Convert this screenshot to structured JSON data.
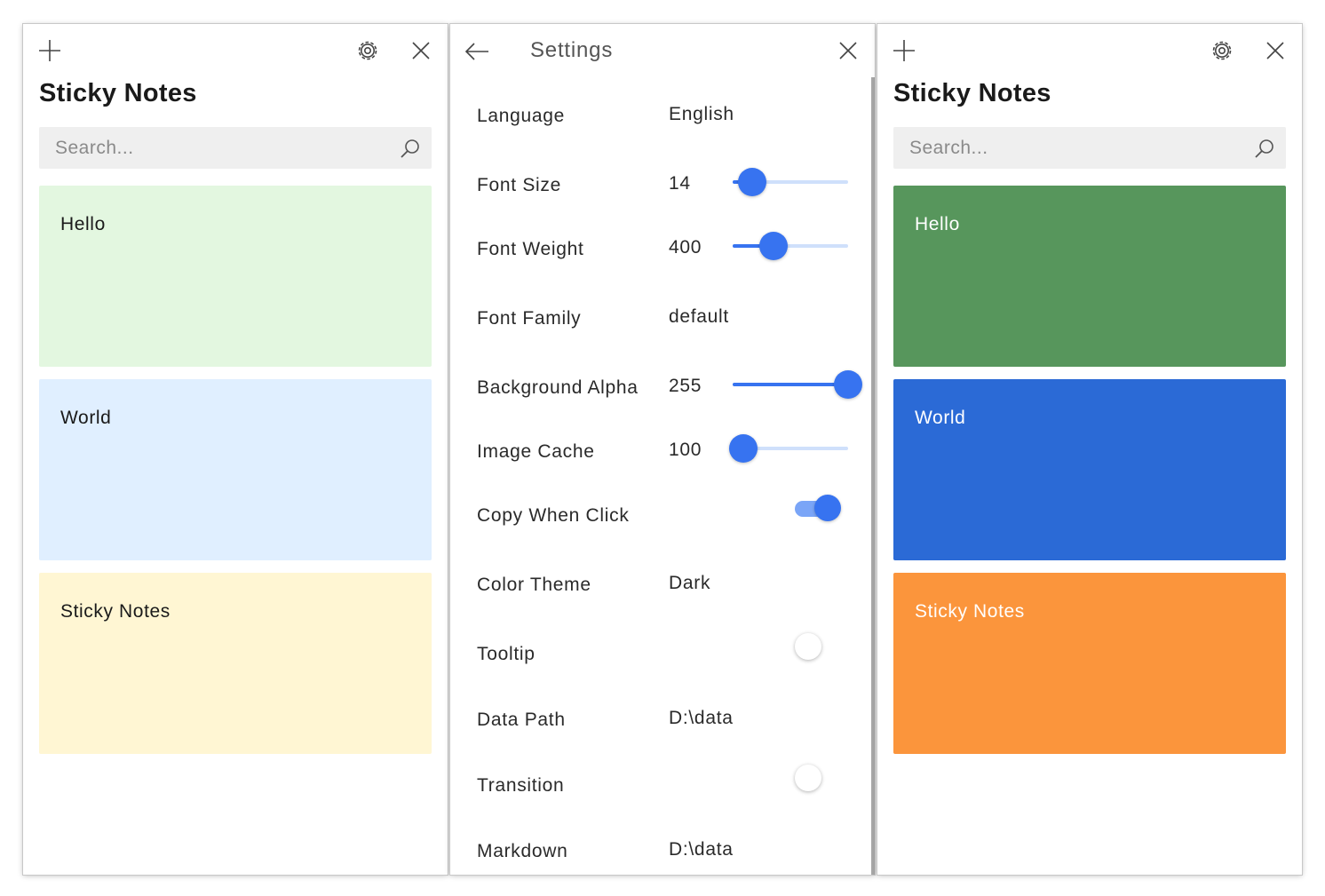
{
  "left_window": {
    "title": "Sticky Notes",
    "search_placeholder": "Search...",
    "icons": {
      "add": "plus-icon",
      "settings": "gear-icon",
      "close": "close-icon",
      "search": "search-icon"
    },
    "notes": [
      {
        "text": "Hello",
        "bg": "#e3f7e0",
        "fg": "#1a1a1a"
      },
      {
        "text": "World",
        "bg": "#e0efff",
        "fg": "#1a1a1a"
      },
      {
        "text": "Sticky Notes",
        "bg": "#fff6d3",
        "fg": "#1a1a1a"
      }
    ]
  },
  "settings_window": {
    "title": "Settings",
    "icons": {
      "back": "arrow-left-icon",
      "close": "close-icon"
    },
    "accent_color": "#3773f0",
    "rows": [
      {
        "label": "Language",
        "value": "English",
        "control": "text"
      },
      {
        "label": "Font Size",
        "value": "14",
        "control": "slider",
        "level": 0.17
      },
      {
        "label": "Font Weight",
        "value": "400",
        "control": "slider",
        "level": 0.35
      },
      {
        "label": "Font Family",
        "value": "default",
        "control": "text"
      },
      {
        "label": "Background Alpha",
        "value": "255",
        "control": "slider",
        "level": 1.0
      },
      {
        "label": "Image Cache",
        "value": "100",
        "control": "slider",
        "level": 0.09
      },
      {
        "label": "Copy When Click",
        "value": "",
        "control": "toggle",
        "on": true
      },
      {
        "label": "Color Theme",
        "value": "Dark",
        "control": "text"
      },
      {
        "label": "Tooltip",
        "value": "",
        "control": "toggle",
        "on": false
      },
      {
        "label": "Data Path",
        "value": "D:\\data",
        "control": "text"
      },
      {
        "label": "Transition",
        "value": "",
        "control": "toggle",
        "on": false
      },
      {
        "label": "Markdown",
        "value": "D:\\data",
        "control": "text"
      }
    ]
  },
  "right_window": {
    "title": "Sticky Notes",
    "search_placeholder": "Search...",
    "icons": {
      "add": "plus-icon",
      "settings": "gear-icon",
      "close": "close-icon",
      "search": "search-icon"
    },
    "notes": [
      {
        "text": "Hello",
        "bg": "#57965c",
        "fg": "#ffffff"
      },
      {
        "text": "World",
        "bg": "#2b6ad6",
        "fg": "#ffffff"
      },
      {
        "text": "Sticky Notes",
        "bg": "#fb953c",
        "fg": "#ffffff"
      }
    ]
  }
}
